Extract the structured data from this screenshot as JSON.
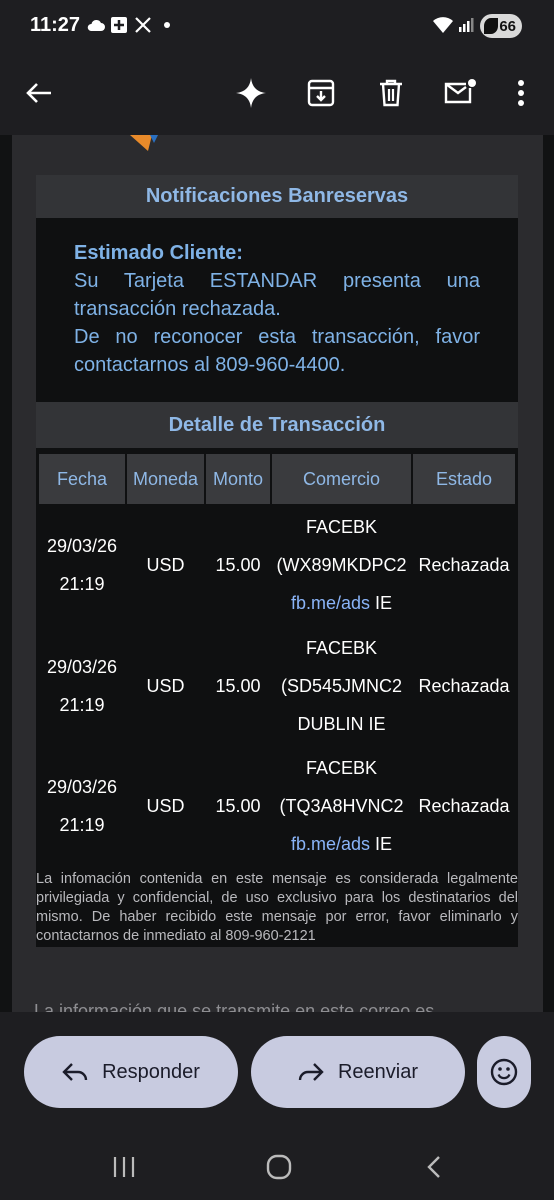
{
  "status_bar": {
    "time": "11:27",
    "battery": "66",
    "icons": [
      "cloud-icon",
      "plus-box-icon",
      "x-logo-icon",
      "dot-icon",
      "wifi-icon",
      "signal-icon",
      "battery-icon"
    ]
  },
  "toolbar": {
    "icons": [
      "back-arrow-icon",
      "sparkle-icon",
      "archive-icon",
      "delete-icon",
      "mark-unread-icon",
      "more-vert-icon"
    ]
  },
  "email": {
    "header_title": "Notificaciones Banreservas",
    "greeting": "Estimado Cliente:",
    "message_line1": "Su Tarjeta ESTANDAR presenta una",
    "message_line2": "transacción rechazada.",
    "message_line3": "De no reconocer esta transacción, favor",
    "message_line4": "contactarnos al 809-960-4400.",
    "detail_title": "Detalle de Transacción",
    "columns": [
      "Fecha",
      "Moneda",
      "Monto",
      "Comercio",
      "Estado"
    ],
    "rows": [
      {
        "fecha_date": "29/03/26",
        "fecha_time": "21:19",
        "moneda": "USD",
        "monto": "15.00",
        "comercio_l1": "FACEBK",
        "comercio_l2": "(WX89MKDPC2",
        "comercio_link": "fb.me/ads",
        "comercio_suffix": " IE",
        "estado": "Rechazada"
      },
      {
        "fecha_date": "29/03/26",
        "fecha_time": "21:19",
        "moneda": "USD",
        "monto": "15.00",
        "comercio_l1": "FACEBK",
        "comercio_l2": "(SD545JMNC2",
        "comercio_l3": "DUBLIN IE",
        "estado": "Rechazada"
      },
      {
        "fecha_date": "29/03/26",
        "fecha_time": "21:19",
        "moneda": "USD",
        "monto": "15.00",
        "comercio_l1": "FACEBK",
        "comercio_l2": "(TQ3A8HVNC2",
        "comercio_link": "fb.me/ads",
        "comercio_suffix": " IE",
        "estado": "Rechazada"
      }
    ],
    "disclaimer": "La infomación contenida en este mensaje es considerada legalmente privilegiada y confidencial, de uso exclusivo para los destinatarios del mismo. De haber recibido este mensaje por error, favor eliminarlo y contactarnos de inmediato al 809-960-2121",
    "cut_text": "La información que se transmite en este correo es"
  },
  "actions": {
    "reply_label": "Responder",
    "forward_label": "Reenviar"
  },
  "colors": {
    "accent_blue": "#8fb8e6",
    "link_blue": "#8ab4f8",
    "pill_bg": "#c8cbe0"
  }
}
